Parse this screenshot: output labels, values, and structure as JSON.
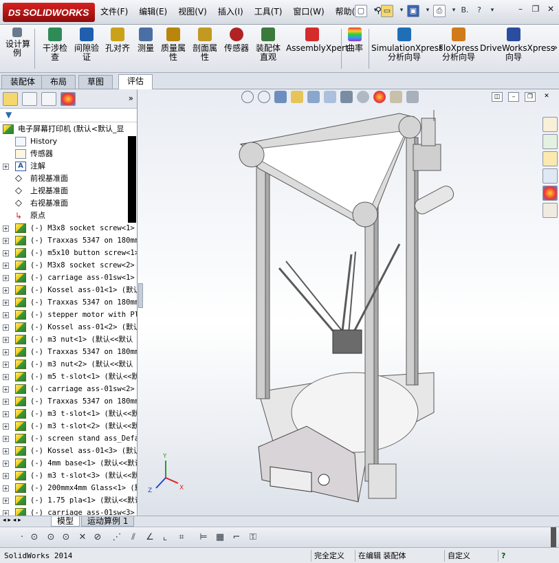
{
  "app": {
    "brand": "SOLIDWORKS",
    "brand_prefix": "DS"
  },
  "menu": [
    "文件(F)",
    "编辑(E)",
    "视图(V)",
    "插入(I)",
    "工具(T)",
    "窗口(W)",
    "帮助(H)"
  ],
  "quick_access": {
    "extra": "B.",
    "help": "?"
  },
  "ribbon": {
    "buttons": [
      {
        "label": "设计算\n例",
        "icon": "design-study-icon",
        "color": "#6a7a8c"
      },
      {
        "label": "干涉检\n查",
        "icon": "interference-check-icon",
        "color": "#2e8b57"
      },
      {
        "label": "间隙验\n证",
        "icon": "clearance-verify-icon",
        "color": "#1f5fae"
      },
      {
        "label": "孔对齐",
        "icon": "hole-alignment-icon",
        "color": "#c9a21a"
      },
      {
        "label": "测量",
        "icon": "measure-icon",
        "color": "#4a6fa5"
      },
      {
        "label": "质量属\n性",
        "icon": "mass-properties-icon",
        "color": "#b8860b"
      },
      {
        "label": "剖面属\n性",
        "icon": "section-properties-icon",
        "color": "#c29a21"
      },
      {
        "label": "传感器",
        "icon": "sensor-icon",
        "color": "#b22222"
      },
      {
        "label": "装配体\n直观",
        "icon": "assembly-visualization-icon",
        "color": "#3b7a3b"
      },
      {
        "label": "AssemblyXpert",
        "icon": "assemblyxpert-icon",
        "color": "#d62b2b"
      },
      {
        "label": "曲率",
        "icon": "curvature-icon",
        "color": "#9b30c9"
      },
      {
        "label": "SimulationXpress\n分析向导",
        "icon": "simulationxpress-icon",
        "color": "#1e6fb8"
      },
      {
        "label": "FloXpress\n分析向导",
        "icon": "floxpress-icon",
        "color": "#d07a1a"
      },
      {
        "label": "DriveWorksXpress\n向导",
        "icon": "driveworksxpress-icon",
        "color": "#2a4da0"
      }
    ],
    "more": "»"
  },
  "tabs": [
    "装配体",
    "布局",
    "草图",
    "评估"
  ],
  "active_tab": "评估",
  "pane_tabs_more": "»",
  "tree": {
    "root": "电子屏幕打印机  (默认<默认_显",
    "features": [
      "History",
      "传感器",
      "注解",
      "前视基准面",
      "上视基准面",
      "右视基准面",
      "原点"
    ],
    "components": [
      "(-) M3x8 socket screw<1> (",
      "(-) Traxxas 5347 on 180mm",
      "(-) m5x10 button screw<1>",
      "(-) M3x8 socket screw<2> (",
      "(-) carriage ass-01sw<1> (",
      "(-) Kossel ass-01<1> (默认",
      "(-) Traxxas 5347 on 180mm",
      "(-) stepper motor with Pla",
      "(-) Kossel ass-01<2> (默认",
      "(-) m3 nut<1> (默认<<默认",
      "(-) Traxxas 5347 on 180mm",
      "(-) m3 nut<2> (默认<<默认",
      "(-) m5 t-slot<1> (默认<<默",
      "(-) carriage ass-01sw<2> (",
      "(-) Traxxas 5347 on 180mm",
      "(-) m3 t-slot<1> (默认<<默",
      "(-) m3 t-slot<2> (默认<<默",
      "(-) screen stand ass_Defau",
      "(-) Kossel ass-01<3> (默认",
      "(-) 4mm base<1> (默认<<默认",
      "(-) m3 t-slot<3> (默认<<默",
      "(-) 200mmx4mm Glass<1> (默",
      "(-) 1.75 pla<1> (默认<<默认",
      "(-) carriage ass-01sw<3> ("
    ]
  },
  "bottom_tabs": [
    "模型",
    "运动算例 1"
  ],
  "status": {
    "app_version": "SolidWorks 2014",
    "definition": "完全定义",
    "mode": "在编辑 装配体",
    "units": "自定义",
    "help": "?"
  },
  "triad": {
    "x": "X",
    "y": "Y",
    "z": "Z"
  },
  "colors": {
    "accent_red": "#c8161d",
    "tree_icon_yellow": "#f0c419",
    "tree_icon_green": "#2e7d2e"
  }
}
